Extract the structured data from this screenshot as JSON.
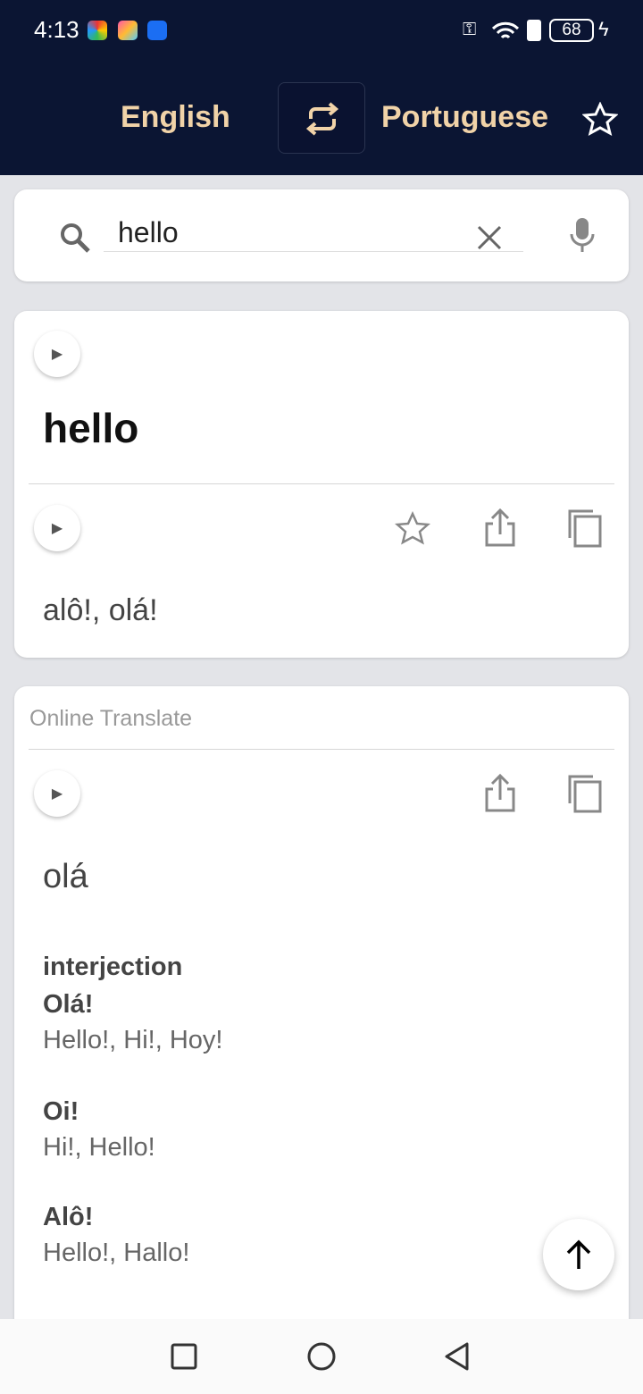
{
  "status_bar": {
    "time": "4:13",
    "battery": "68"
  },
  "header": {
    "source_lang": "English",
    "target_lang": "Portuguese",
    "swap_icon": "swap-icon",
    "favorite_icon": "star-outline-icon"
  },
  "search": {
    "value": "hello",
    "placeholder": ""
  },
  "dictionary_card": {
    "word": "hello",
    "translation": "alô!, olá!"
  },
  "online_card": {
    "title": "Online Translate",
    "translation": "olá",
    "part_of_speech": "interjection",
    "entries": [
      {
        "term": "Olá!",
        "meanings": "Hello!, Hi!, Hoy!"
      },
      {
        "term": "Oi!",
        "meanings": "Hi!, Hello!"
      },
      {
        "term": "Alô!",
        "meanings": "Hello!, Hallo!"
      }
    ]
  },
  "colors": {
    "header_bg": "#0b1533",
    "lang_text": "#f1d3a8"
  }
}
